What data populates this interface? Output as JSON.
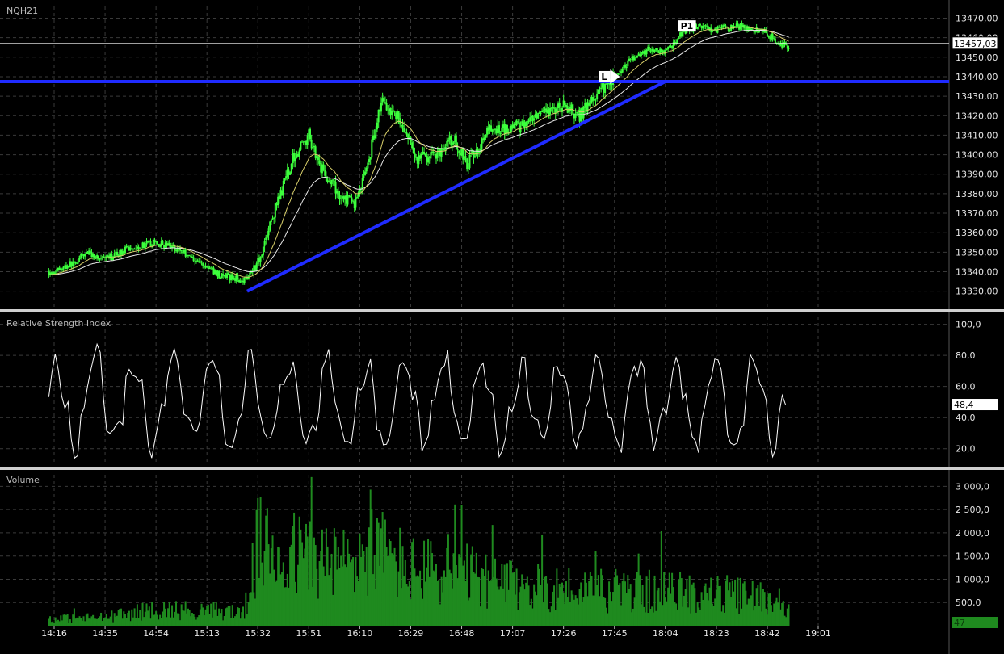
{
  "colors": {
    "background": "#000000",
    "grid": "#3a3a3a",
    "candle": "#3cff3c",
    "ma_fast": "#d8cf6a",
    "ma_slow": "#e8e8e8",
    "trendline": "#1f2bff",
    "rsi_line": "#ffffff",
    "volume_bar": "#1f8a1f",
    "separator": "#cfcfcf"
  },
  "chart_data": [
    {
      "type": "line",
      "title": "NQH21",
      "chart_style": "candlestick",
      "x_ticks": [
        "14:16",
        "14:35",
        "14:54",
        "15:13",
        "15:32",
        "15:51",
        "16:10",
        "16:29",
        "16:48",
        "17:07",
        "17:26",
        "17:45",
        "18:04",
        "18:23",
        "18:42",
        "19:01"
      ],
      "ylim": [
        13322,
        13476
      ],
      "y_ticks": [
        "13470,00",
        "13460,00",
        "13450,00",
        "13440,00",
        "13430,00",
        "13420,00",
        "13410,00",
        "13400,00",
        "13390,00",
        "13380,00",
        "13370,00",
        "13360,00",
        "13350,00",
        "13340,00",
        "13330,00"
      ],
      "y_tick_values": [
        13470,
        13460,
        13450,
        13440,
        13430,
        13420,
        13410,
        13400,
        13390,
        13380,
        13370,
        13360,
        13350,
        13340,
        13330
      ],
      "last_price_label": "13457,03",
      "last_price": 13457.03,
      "horizontal_line_value": 13437.5,
      "trendline": {
        "from": {
          "x": "15:28",
          "y": 13330
        },
        "to": {
          "x": "18:04",
          "y": 13437.5
        }
      },
      "markers": [
        {
          "label": "L",
          "x": "17:44",
          "y": 13440
        },
        {
          "label": "P1",
          "x": "18:16",
          "y": 13466
        }
      ],
      "close_knots": [
        [
          "14:16",
          13340
        ],
        [
          "14:24",
          13345
        ],
        [
          "14:28",
          13350
        ],
        [
          "14:35",
          13346
        ],
        [
          "14:44",
          13352
        ],
        [
          "14:54",
          13355
        ],
        [
          "15:02",
          13352
        ],
        [
          "15:10",
          13345
        ],
        [
          "15:18",
          13338
        ],
        [
          "15:27",
          13336
        ],
        [
          "15:32",
          13345
        ],
        [
          "15:38",
          13370
        ],
        [
          "15:45",
          13398
        ],
        [
          "15:51",
          13410
        ],
        [
          "15:56",
          13392
        ],
        [
          "16:03",
          13378
        ],
        [
          "16:08",
          13375
        ],
        [
          "16:13",
          13395
        ],
        [
          "16:18",
          13428
        ],
        [
          "16:24",
          13420
        ],
        [
          "16:31",
          13398
        ],
        [
          "16:38",
          13400
        ],
        [
          "16:45",
          13408
        ],
        [
          "16:50",
          13395
        ],
        [
          "16:58",
          13412
        ],
        [
          "17:05",
          13414
        ],
        [
          "17:12",
          13415
        ],
        [
          "17:18",
          13420
        ],
        [
          "17:26",
          13425
        ],
        [
          "17:32",
          13420
        ],
        [
          "17:38",
          13430
        ],
        [
          "17:45",
          13440
        ],
        [
          "17:52",
          13450
        ],
        [
          "17:58",
          13454
        ],
        [
          "18:04",
          13452
        ],
        [
          "18:10",
          13462
        ],
        [
          "18:16",
          13466
        ],
        [
          "18:23",
          13464
        ],
        [
          "18:30",
          13466
        ],
        [
          "18:36",
          13465
        ],
        [
          "18:42",
          13462
        ],
        [
          "18:47",
          13457
        ],
        [
          "18:50",
          13455
        ]
      ]
    },
    {
      "type": "line",
      "title": "Relative Strength Index",
      "ylim": [
        10,
        105
      ],
      "y_ticks": [
        "100,0",
        "80,0",
        "60,0",
        "40,0",
        "20,0"
      ],
      "y_tick_values": [
        100,
        80,
        60,
        40,
        20
      ],
      "last_value_label": "48,4",
      "last_value": 48.4
    },
    {
      "type": "bar",
      "title": "Volume",
      "ylim": [
        0,
        3250
      ],
      "y_ticks": [
        "3 000,0",
        "2 500,0",
        "2 000,0",
        "1 500,0",
        "1 000,0",
        "500,0"
      ],
      "y_tick_values": [
        3000,
        2500,
        2000,
        1500,
        1000,
        500
      ],
      "last_value_label": "47",
      "last_value": 47,
      "volume_knots": [
        [
          "14:16",
          150
        ],
        [
          "14:35",
          180
        ],
        [
          "14:54",
          350
        ],
        [
          "15:13",
          320
        ],
        [
          "15:27",
          300
        ],
        [
          "15:32",
          1700
        ],
        [
          "15:40",
          1550
        ],
        [
          "15:51",
          1500
        ],
        [
          "16:03",
          1300
        ],
        [
          "16:15",
          1650
        ],
        [
          "16:29",
          1200
        ],
        [
          "16:48",
          1100
        ],
        [
          "17:07",
          850
        ],
        [
          "17:26",
          800
        ],
        [
          "17:45",
          750
        ],
        [
          "18:04",
          720
        ],
        [
          "18:23",
          680
        ],
        [
          "18:42",
          600
        ],
        [
          "18:50",
          500
        ]
      ]
    }
  ]
}
